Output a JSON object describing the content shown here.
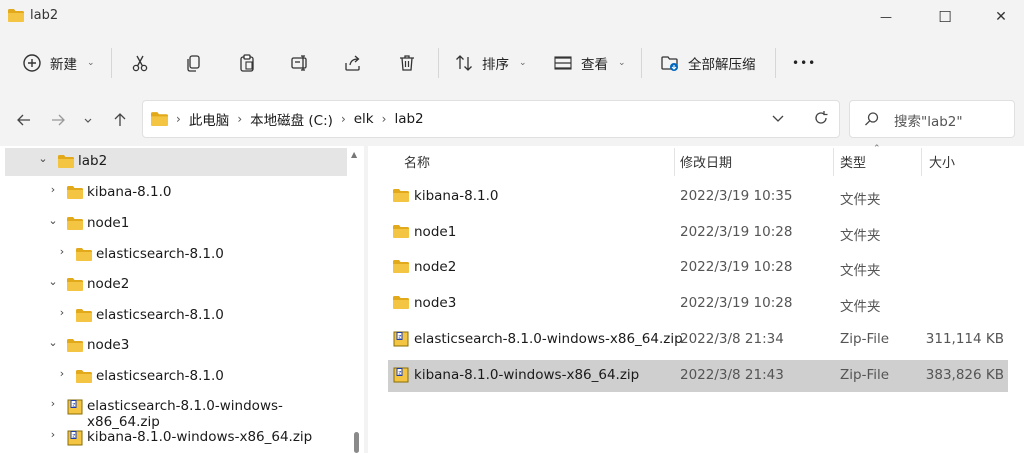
{
  "window": {
    "title": "lab2",
    "minimize_glyph": "—",
    "maximize_glyph": "☐",
    "close_glyph": "✕"
  },
  "toolbar": {
    "new_label": "新建",
    "sort_label": "排序",
    "view_label": "查看",
    "extract_all_label": "全部解压缩",
    "more_glyph": "•••"
  },
  "address": {
    "crumbs": [
      "此电脑",
      "本地磁盘 (C:)",
      "elk",
      "lab2"
    ]
  },
  "search": {
    "placeholder": "搜索\"lab2\""
  },
  "nav_tree": [
    {
      "label": "lab2",
      "chevron": "⌄",
      "icon": "folder-icon",
      "selected": true
    },
    {
      "label": "kibana-8.1.0",
      "chevron": "›",
      "icon": "folder-icon"
    },
    {
      "label": "node1",
      "chevron": "⌄",
      "icon": "folder-icon"
    },
    {
      "label": "elasticsearch-8.1.0",
      "chevron": "›",
      "icon": "folder-icon"
    },
    {
      "label": "node2",
      "chevron": "⌄",
      "icon": "folder-icon"
    },
    {
      "label": "elasticsearch-8.1.0",
      "chevron": "›",
      "icon": "folder-icon"
    },
    {
      "label": "node3",
      "chevron": "⌄",
      "icon": "folder-icon"
    },
    {
      "label": "elasticsearch-8.1.0",
      "chevron": "›",
      "icon": "folder-icon"
    },
    {
      "label": "elasticsearch-8.1.0-windows-x86_64.zip",
      "chevron": "›",
      "icon": "zip-icon"
    },
    {
      "label": "kibana-8.1.0-windows-x86_64.zip",
      "chevron": "›",
      "icon": "zip-icon"
    }
  ],
  "columns": {
    "name": "名称",
    "date": "修改日期",
    "type": "类型",
    "size": "大小"
  },
  "files": [
    {
      "name": "kibana-8.1.0",
      "date": "2022/3/19 10:35",
      "type": "文件夹",
      "size": "",
      "icon": "folder-icon"
    },
    {
      "name": "node1",
      "date": "2022/3/19 10:28",
      "type": "文件夹",
      "size": "",
      "icon": "folder-icon"
    },
    {
      "name": "node2",
      "date": "2022/3/19 10:28",
      "type": "文件夹",
      "size": "",
      "icon": "folder-icon"
    },
    {
      "name": "node3",
      "date": "2022/3/19 10:28",
      "type": "文件夹",
      "size": "",
      "icon": "folder-icon"
    },
    {
      "name": "elasticsearch-8.1.0-windows-x86_64.zip",
      "date": "2022/3/8 21:34",
      "type": "Zip-File",
      "size": "311,114 KB",
      "icon": "zip-icon"
    },
    {
      "name": "kibana-8.1.0-windows-x86_64.zip",
      "date": "2022/3/8 21:43",
      "type": "Zip-File",
      "size": "383,826 KB",
      "icon": "zip-icon",
      "selected": true
    }
  ],
  "colors": {
    "folder": "#f4c542",
    "folder_dark": "#e2a91b",
    "selected_row": "#cfcfcf",
    "accent": "#0067c0"
  }
}
